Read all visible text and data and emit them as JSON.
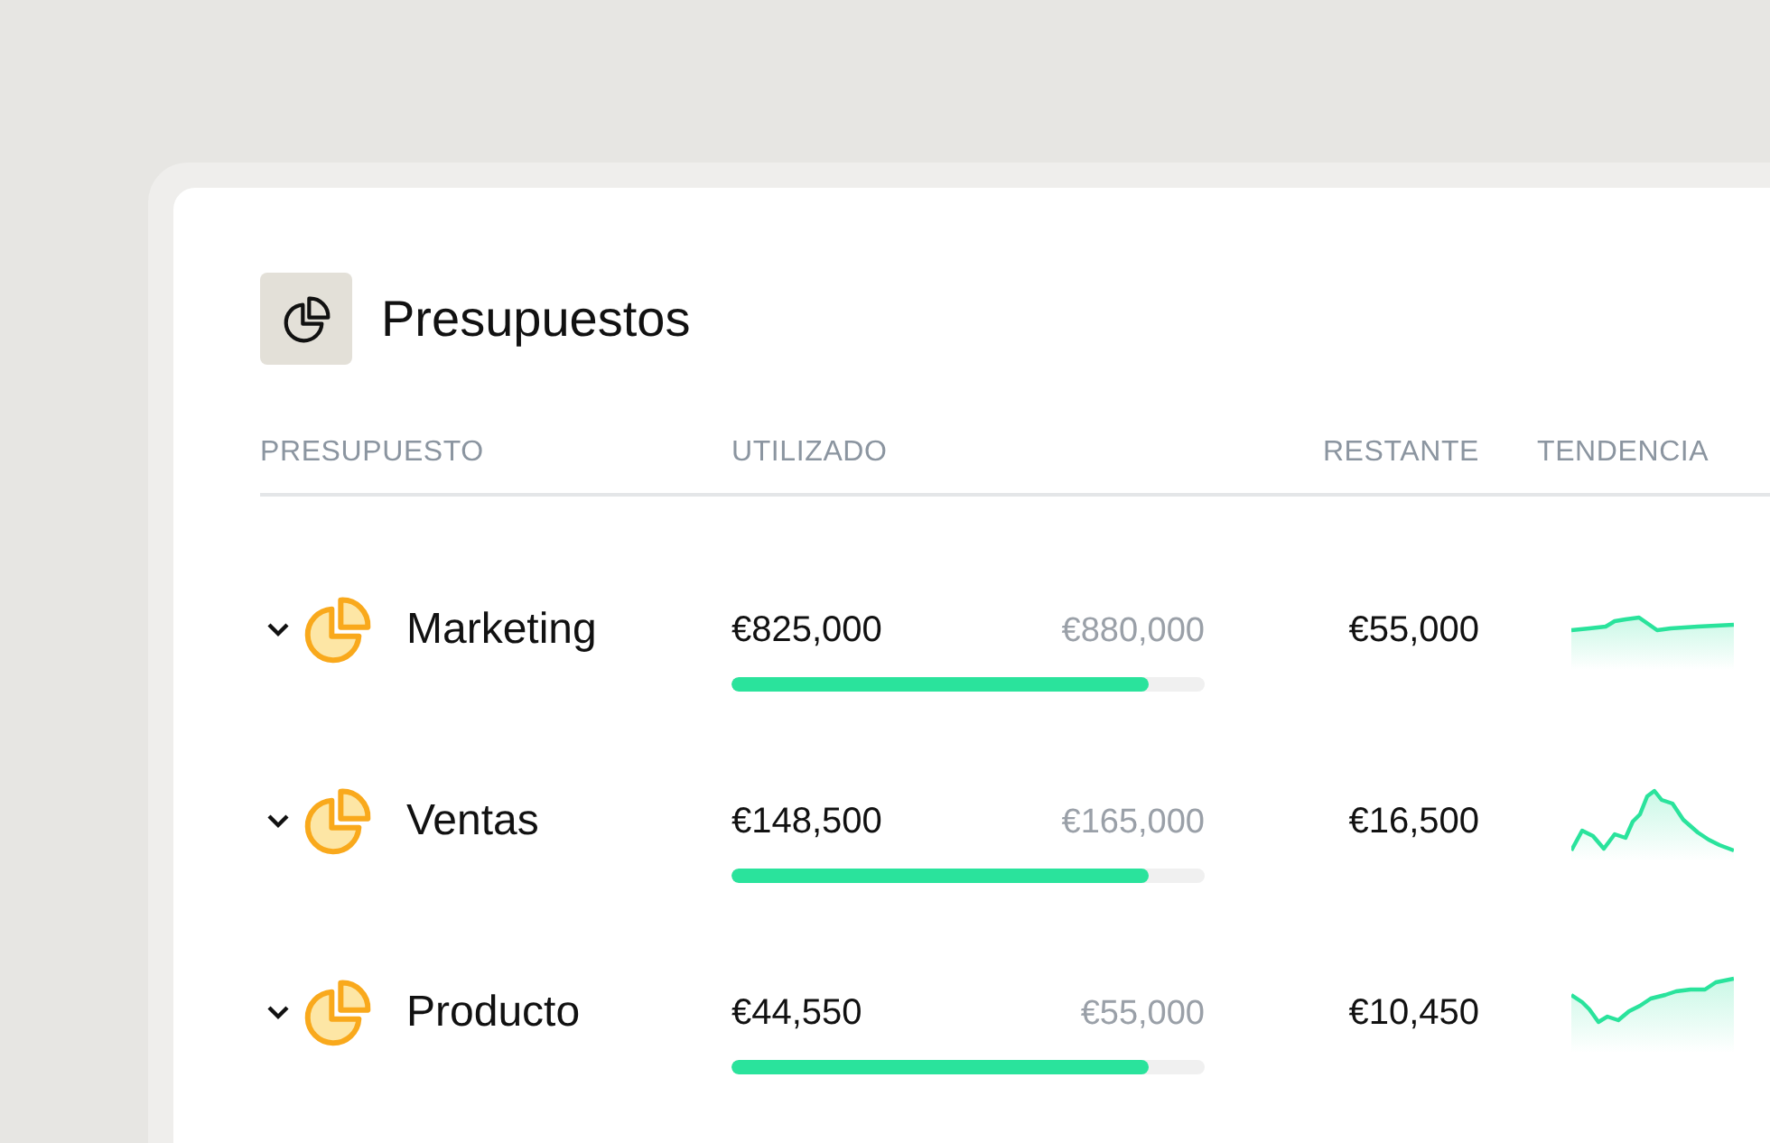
{
  "title": "Presupuestos",
  "columns": [
    "PRESUPUESTO",
    "UTILIZADO",
    "RESTANTE",
    "TENDENCIA"
  ],
  "rows": [
    {
      "name": "Marketing",
      "used": "€825,000",
      "total": "€880,000",
      "level": 0.88,
      "remaining": "€55,000"
    },
    {
      "name": "Ventas",
      "used": "€148,500",
      "total": "€165,000",
      "level": 0.88,
      "remaining": "€16,500"
    },
    {
      "name": "Producto",
      "used": "€44,550",
      "total": "€55,000",
      "level": 0.88,
      "remaining": "€10,450"
    }
  ]
}
